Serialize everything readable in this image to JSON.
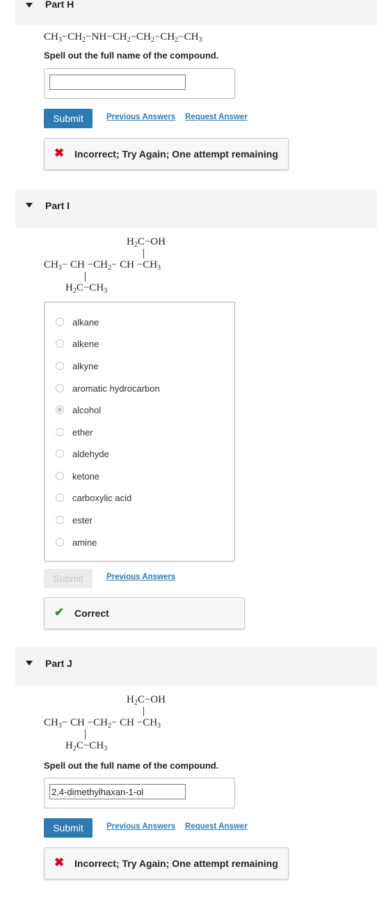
{
  "partH": {
    "title": "Part H",
    "formula": {
      "c1": "CH",
      "s1": "3",
      "c2": "−CH",
      "s2": "2",
      "c3": "−NH−CH",
      "s3": "2",
      "c4": "−CH",
      "s4": "2",
      "c5": "−CH",
      "s5": "2",
      "c6": "−CH",
      "s6": "3"
    },
    "instruction": "Spell out the full name of the compound.",
    "answer_value": "",
    "submit_label": "Submit",
    "previous_answers_label": "Previous Answers",
    "request_answer_label": "Request Answer",
    "feedback_icon": "✖",
    "feedback_text": "Incorrect; Try Again; One attempt remaining"
  },
  "partI": {
    "title": "Part I",
    "structure": {
      "top": "H",
      "top_sub": "2",
      "top_rest": "C−OH",
      "main1": "CH",
      "main1_sub": "3",
      "main2": "− CH −CH",
      "main2_sub": "2",
      "main3": "− CH −CH",
      "main3_sub": "3",
      "bottom": "H",
      "bottom_sub": "2",
      "bottom_mid": "C−CH",
      "bottom_sub2": "3"
    },
    "options": [
      "alkane",
      "alkene",
      "alkyne",
      "aromatic hydrocarbon",
      "alcohol",
      "ether",
      "aldehyde",
      "ketone",
      "carboxylic acid",
      "ester",
      "amine"
    ],
    "selected_option": "alcohol",
    "submit_label": "Submit",
    "previous_answers_label": "Previous Answers",
    "feedback_icon": "✔",
    "feedback_text": "Correct"
  },
  "partJ": {
    "title": "Part J",
    "structure": {
      "top": "H",
      "top_sub": "2",
      "top_rest": "C−OH",
      "main1": "CH",
      "main1_sub": "3",
      "main2": "− CH −CH",
      "main2_sub": "2",
      "main3": "− CH −CH",
      "main3_sub": "3",
      "bottom": "H",
      "bottom_sub": "2",
      "bottom_mid": "C−CH",
      "bottom_sub2": "3"
    },
    "instruction": "Spell out the full name of the compound.",
    "answer_value": "2,4-dimethylhaxan-1-ol",
    "submit_label": "Submit",
    "previous_answers_label": "Previous Answers",
    "request_answer_label": "Request Answer",
    "feedback_icon": "✖",
    "feedback_text": "Incorrect; Try Again; One attempt remaining"
  },
  "colors": {
    "accent": "#2e7bb4",
    "error": "#d0021b",
    "success": "#2e8b3a",
    "header_bg": "#f4f4f4"
  }
}
